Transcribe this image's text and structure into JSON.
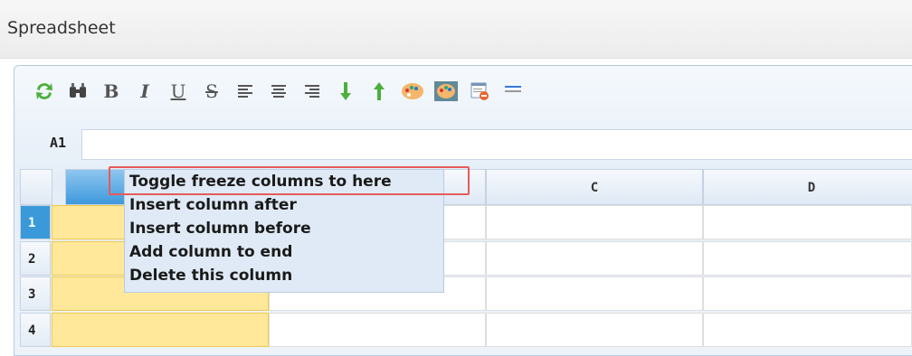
{
  "window": {
    "title": "Spreadsheet"
  },
  "toolbar": {
    "items": [
      {
        "name": "refresh-icon"
      },
      {
        "name": "find-icon"
      },
      {
        "name": "bold-icon",
        "glyph": "B"
      },
      {
        "name": "italic-icon",
        "glyph": "I"
      },
      {
        "name": "underline-icon",
        "glyph": "U"
      },
      {
        "name": "strikethrough-icon",
        "glyph": "S"
      },
      {
        "name": "align-left-icon"
      },
      {
        "name": "align-center-icon"
      },
      {
        "name": "align-right-icon"
      },
      {
        "name": "sort-descending-icon"
      },
      {
        "name": "sort-ascending-icon"
      },
      {
        "name": "background-color-icon"
      },
      {
        "name": "text-color-icon"
      },
      {
        "name": "cell-properties-icon"
      },
      {
        "name": "wrap-text-icon"
      }
    ]
  },
  "formula_bar": {
    "cell_ref": "A1",
    "value": ""
  },
  "columns": [
    "",
    "",
    "C",
    "D"
  ],
  "rows": [
    "1",
    "2",
    "3",
    "4"
  ],
  "selected_row": "1",
  "context_menu": {
    "items": [
      "Toggle freeze columns to here",
      "Insert column after",
      "Insert column before",
      "Add column to end",
      "Delete this column"
    ],
    "highlighted": "Toggle freeze columns to here"
  },
  "colors": {
    "selection": "#ffe89a",
    "accent": "#3a9ad9",
    "highlight_border": "#e85a5a"
  }
}
